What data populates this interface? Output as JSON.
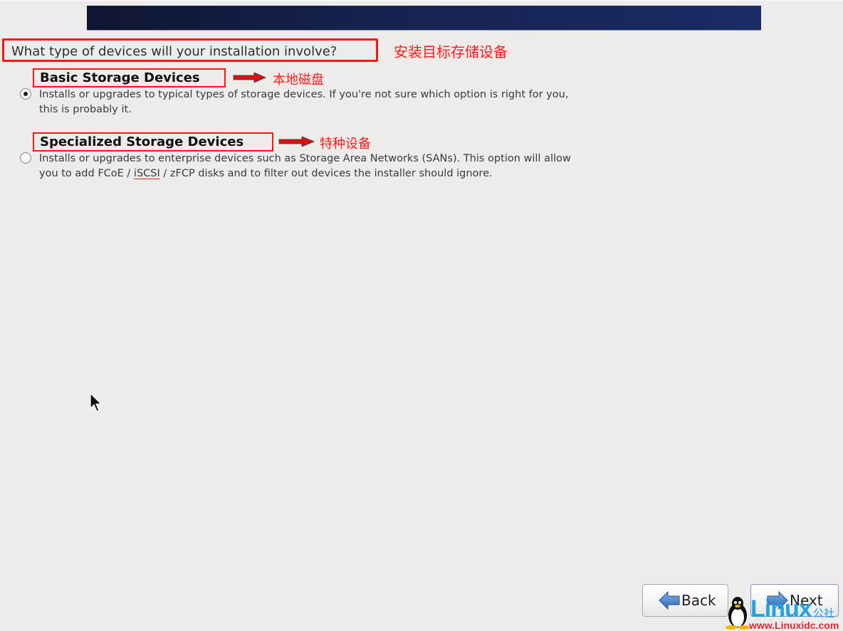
{
  "header": {
    "banner_color": "#152350"
  },
  "question": {
    "text": "What type of devices will your installation involve?",
    "annotation": "安装目标存储设备"
  },
  "options": [
    {
      "title": "Basic Storage Devices",
      "annotation": "本地磁盘",
      "selected": true,
      "description_lines": [
        "Installs or upgrades to typical types of storage devices.  If you're not sure which option is right for you,",
        "this is probably it."
      ]
    },
    {
      "title": "Specialized Storage Devices",
      "annotation": "特种设备",
      "selected": false,
      "description_line1": "Installs or upgrades to enterprise devices such as Storage Area Networks (SANs). This option will allow",
      "description_line2_pre": "you to add FCoE / ",
      "description_line2_term": "iSCSI",
      "description_line2_post": " / zFCP disks and to filter out devices the installer should ignore."
    }
  ],
  "buttons": {
    "back_label": "Back",
    "next_label": "Next"
  },
  "watermark": {
    "logo": "Linux",
    "logo_cn": "公社",
    "url": "www.Linuxidc.com"
  },
  "colors": {
    "annotation_red": "#ff1414",
    "background": "#edeceb",
    "arrow_icon_blue": "#3a7ac8"
  }
}
